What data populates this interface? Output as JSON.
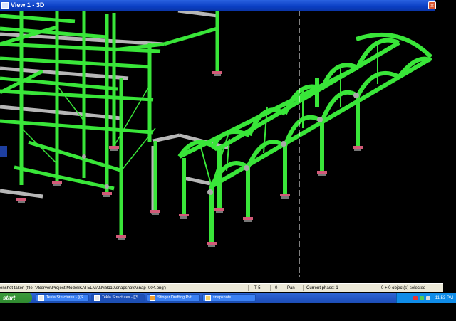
{
  "window": {
    "title": "View 1 - 3D",
    "close_symbol": "×"
  },
  "status": {
    "message": "enshot taken (file: '\\\\Server\\Project Model\\KATELMAN\\#8110\\snapshots\\snap_004.png')",
    "ts": "T 5",
    "zero": "0",
    "pan": "Pan",
    "phase": "Current phase: 1",
    "selected": "0 + 0 object(s) selected"
  },
  "taskbar": {
    "start": "start",
    "items": [
      {
        "label": "Tekla Structures - [(S..."
      },
      {
        "label": "Tekla Structures - [(S..."
      },
      {
        "label": "Stinger Drafting Pvt. ..."
      },
      {
        "label": "snapshots"
      }
    ],
    "clock": "11:53 PM"
  },
  "colors": {
    "member": "#39e639",
    "grating": "#b7b7b7",
    "base": "#d25a78"
  }
}
